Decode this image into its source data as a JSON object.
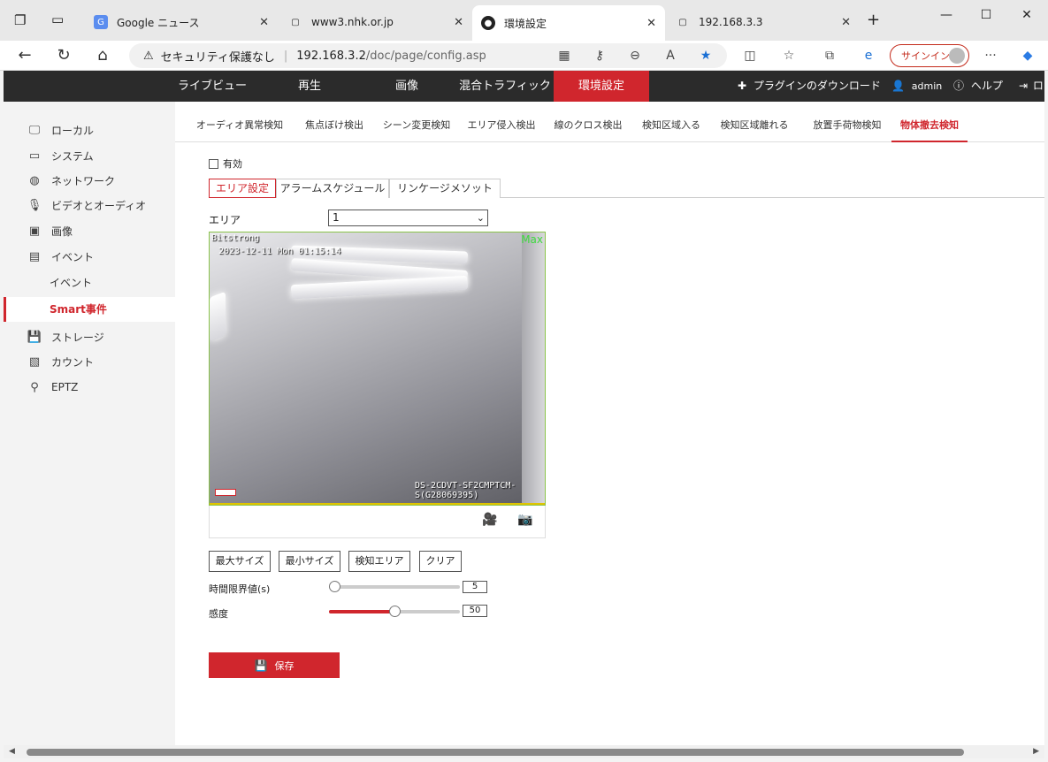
{
  "browser": {
    "tabs": [
      {
        "title": "Google ニュース",
        "icon": "google-news-icon"
      },
      {
        "title": "www3.nhk.or.jp",
        "icon": "page-icon"
      },
      {
        "title": "環境設定",
        "icon": "camera-favicon",
        "active": true
      },
      {
        "title": "192.168.3.3",
        "icon": "page-icon"
      }
    ],
    "new_tab": "+",
    "security_text": "セキュリティ保護なし",
    "url_host": "192.168.3.2",
    "url_path": "/doc/page/config.asp",
    "signin_label": "サインイン"
  },
  "header": {
    "menu": [
      {
        "label": "ライブビュー"
      },
      {
        "label": "再生"
      },
      {
        "label": "画像"
      },
      {
        "label": "混合トラフィック"
      },
      {
        "label": "環境設定",
        "active": true
      }
    ],
    "plugin_download": "プラグインのダウンロード",
    "user": "admin",
    "help": "ヘルプ",
    "logout": "ロ"
  },
  "sidebar": {
    "items": [
      {
        "label": "ローカル",
        "icon": "monitor-icon"
      },
      {
        "label": "システム",
        "icon": "system-icon"
      },
      {
        "label": "ネットワーク",
        "icon": "globe-icon"
      },
      {
        "label": "ビデオとオーディオ",
        "icon": "microphone-icon"
      },
      {
        "label": "画像",
        "icon": "image-icon"
      },
      {
        "label": "イベント",
        "icon": "calendar-icon"
      },
      {
        "label": "ストレージ",
        "icon": "storage-icon"
      },
      {
        "label": "カウント",
        "icon": "count-icon"
      },
      {
        "label": "EPTZ",
        "icon": "ptz-icon"
      }
    ],
    "sub_items": [
      {
        "label": "イベント"
      },
      {
        "label": "Smart事件",
        "active": true
      }
    ]
  },
  "subtabs": [
    {
      "label": "オーディオ異常検知"
    },
    {
      "label": "焦点ぼけ検出"
    },
    {
      "label": "シーン変更検知"
    },
    {
      "label": "エリア侵入検出"
    },
    {
      "label": "線のクロス検出"
    },
    {
      "label": "検知区域入る"
    },
    {
      "label": "検知区域離れる"
    },
    {
      "label": "放置手荷物検知"
    },
    {
      "label": "物体撤去検知",
      "active": true
    }
  ],
  "form": {
    "enable_label": "有効",
    "enabled": false,
    "steps": [
      {
        "label": "エリア設定",
        "active": true
      },
      {
        "label": "アラームスケジュール"
      },
      {
        "label": "リンケージメソット"
      }
    ],
    "area_label": "エリア",
    "area_value": "1",
    "buttons": {
      "max_size": "最大サイズ",
      "min_size": "最小サイズ",
      "detect_area": "検知エリア",
      "clear": "クリア"
    },
    "time_threshold": {
      "label": "時間限界値(s)",
      "value": "5",
      "fraction": 0.0
    },
    "sensitivity": {
      "label": "感度",
      "value": "50",
      "fraction": 0.5
    },
    "save_label": "保存"
  },
  "video": {
    "brand_osd": "Bitstrong",
    "timestamp_osd": "2023-12-11 Mon 01:15:14",
    "max_label": "Max",
    "device_osd": "DS-2CDVT-SF2CMPTCM-S(G28069395)",
    "logo_text": "Bitstrong"
  },
  "colors": {
    "accent": "#d0262d",
    "header_bg": "#2b2b2b"
  }
}
